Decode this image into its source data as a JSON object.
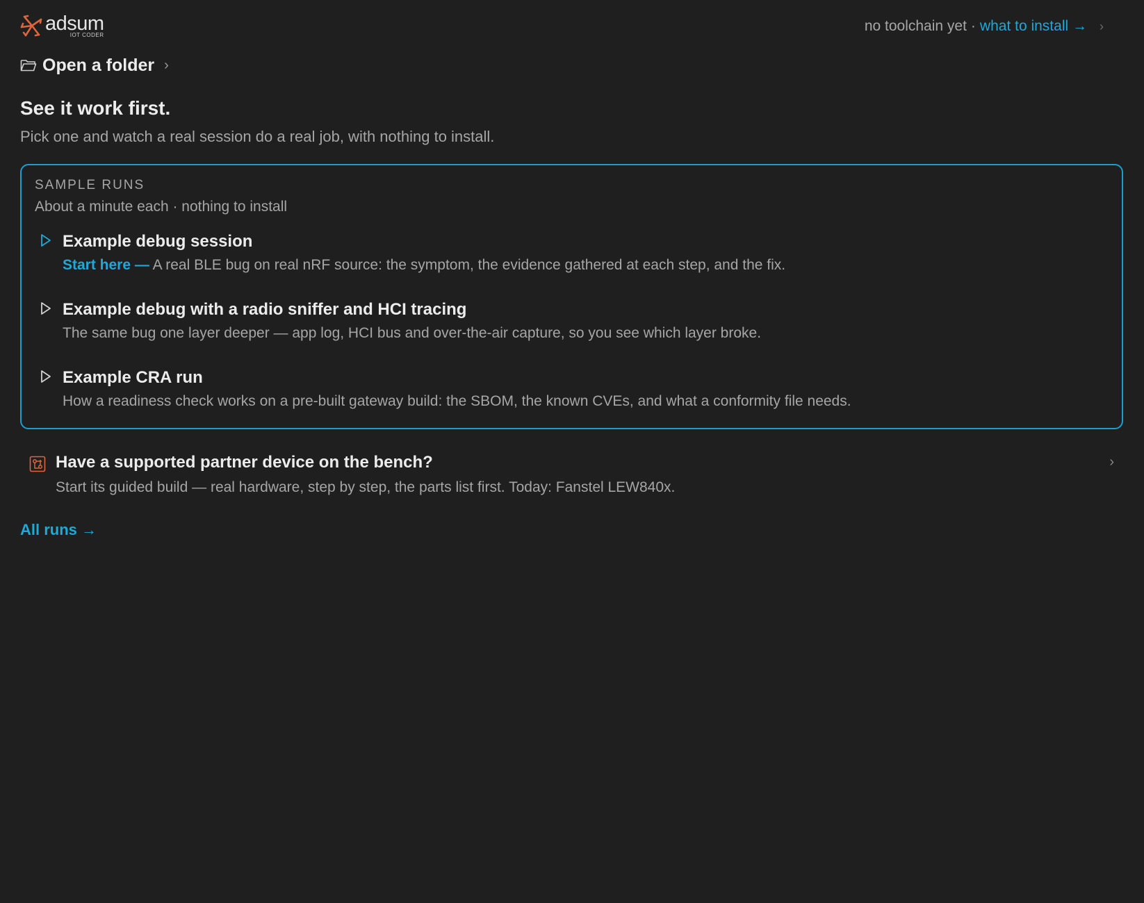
{
  "brand": {
    "name": "adsum",
    "tagline": "IOT CODER",
    "accent_color": "#e0643c"
  },
  "status": {
    "text": "no toolchain yet",
    "separator": "·",
    "link": "what to install →",
    "chevron": "›"
  },
  "folder": {
    "label": "Open a folder",
    "chevron": "›",
    "icon": "folder-icon"
  },
  "intro": {
    "title": "See it work first.",
    "subtitle": "Pick one and watch a real session do a real job, with nothing to install."
  },
  "sample_runs": {
    "kicker": "SAMPLE RUNS",
    "meta": "About a minute each · nothing to install",
    "border_color": "#1b9fd0",
    "items": [
      {
        "title": "Example debug session",
        "accent": "Start here —",
        "description": "A real BLE bug on real nRF source: the symptom, the evidence gathered at each step, and the fix.",
        "icon": "play-icon",
        "highlighted": true
      },
      {
        "title": "Example debug with a radio sniffer and HCI tracing",
        "description": "The same bug one layer deeper — app log, HCI bus and over-the-air capture, so you see which layer broke.",
        "icon": "play-icon"
      },
      {
        "title": "Example CRA run",
        "description": "How a readiness check works on a pre-built gateway build: the SBOM, the known CVEs, and what a conformity file needs.",
        "icon": "play-icon"
      }
    ]
  },
  "partner": {
    "title": "Have a supported partner device on the bench?",
    "description": "Start its guided build — real hardware, step by step, the parts list first. Today: Fanstel LEW840x.",
    "icon": "circuit-board-icon",
    "chevron": "›"
  },
  "all_runs": {
    "label": "All runs →"
  },
  "colors": {
    "link": "#1fa8d8",
    "background": "#1f1f1f"
  }
}
